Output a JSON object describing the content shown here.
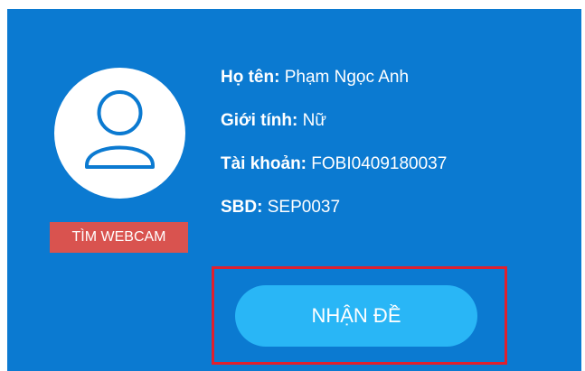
{
  "profile": {
    "avatar_icon": "user-outline-icon",
    "find_webcam_label": "TÌM WEBCAM",
    "fields": [
      {
        "label": "Họ tên:",
        "value": "Phạm Ngọc Anh"
      },
      {
        "label": "Giới tính:",
        "value": "Nữ"
      },
      {
        "label": "Tài khoản:",
        "value": "FOBI0409180037"
      },
      {
        "label": "SBD:",
        "value": "SEP0037"
      }
    ]
  },
  "actions": {
    "get_exam_label": "NHẬN ĐỀ"
  },
  "colors": {
    "panel_background": "#0b7ad1",
    "find_webcam_button": "#d9534f",
    "get_exam_button": "#29b6f6",
    "highlight_border": "#e0202e"
  }
}
